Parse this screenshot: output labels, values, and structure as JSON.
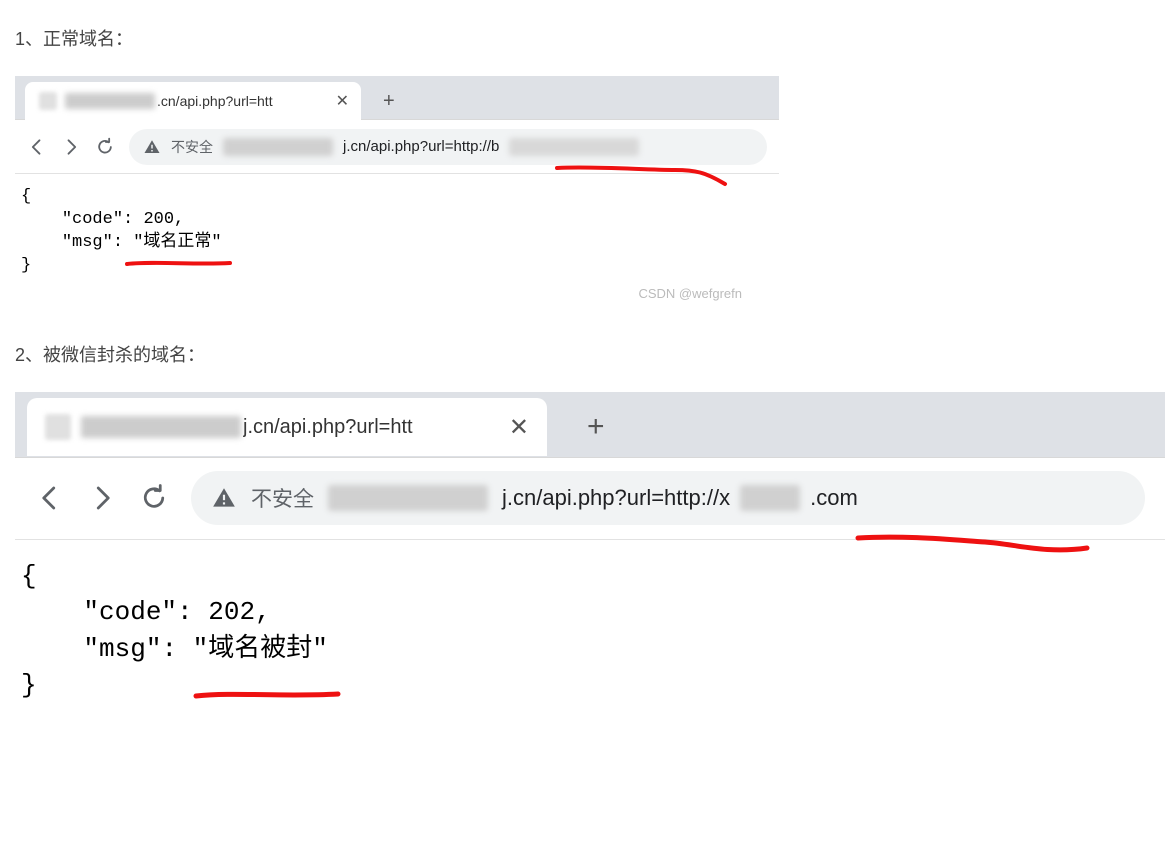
{
  "section1": {
    "title": "1、正常域名：",
    "tab_title_visible": ".cn/api.php?url=htt",
    "insecure_label": "不安全",
    "address_middle": "j.cn/api.php?url=http://b",
    "json_open": "{",
    "json_line1_key": "\"code\"",
    "json_line1_sep": ": ",
    "json_line1_val": "200",
    "json_line1_comma": ",",
    "json_line2_key": "\"msg\"",
    "json_line2_sep": ": ",
    "json_line2_val": "\"域名正常\"",
    "json_close": "}"
  },
  "watermark": "CSDN @wefgrefn",
  "section2": {
    "title": "2、被微信封杀的域名：",
    "tab_title_visible": "j.cn/api.php?url=htt",
    "insecure_label": "不安全",
    "address_middle": "j.cn/api.php?url=http://x",
    "address_tail": ".com",
    "json_open": "{",
    "json_line1_key": "\"code\"",
    "json_line1_sep": ": ",
    "json_line1_val": "202",
    "json_line1_comma": ",",
    "json_line2_key": "\"msg\"",
    "json_line2_sep": ": ",
    "json_line2_val": "\"域名被封\"",
    "json_close": "}"
  }
}
